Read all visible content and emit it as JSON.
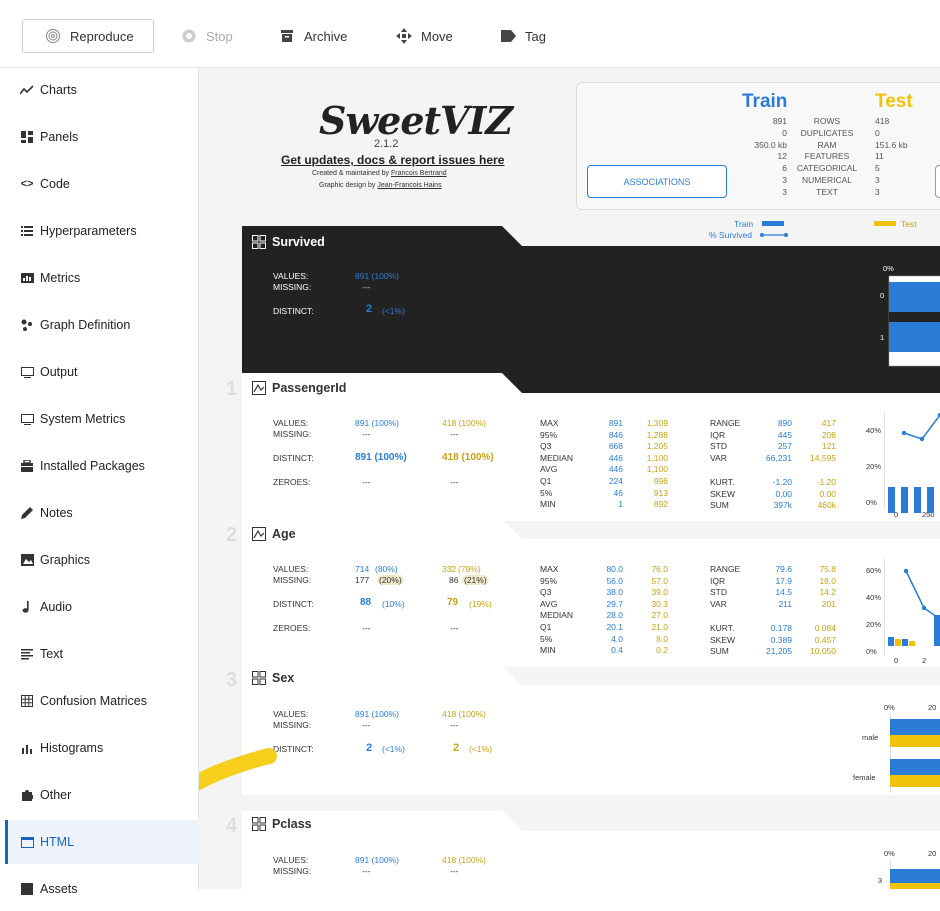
{
  "toolbar": {
    "reproduce": "Reproduce",
    "stop": "Stop",
    "archive": "Archive",
    "move": "Move",
    "tag": "Tag"
  },
  "sidebar": {
    "items": [
      "Charts",
      "Panels",
      "Code",
      "Hyperparameters",
      "Metrics",
      "Graph Definition",
      "Output",
      "System Metrics",
      "Installed Packages",
      "Notes",
      "Graphics",
      "Audio",
      "Text",
      "Confusion Matrices",
      "Histograms",
      "Other",
      "HTML",
      "Assets"
    ],
    "active": "HTML"
  },
  "report": {
    "logo": "SweetVIZ",
    "version": "2.1.2",
    "link": "Get updates, docs & report issues here",
    "credit1": "Created & maintained by",
    "credit1_name": "Francois Bertrand",
    "credit2": "Graphic design by",
    "credit2_name": "Jean-Francois Hains",
    "train_label": "Train",
    "test_label": "Test",
    "summary_rows": [
      {
        "train": "891",
        "label": "ROWS",
        "test": "418"
      },
      {
        "train": "0",
        "label": "DUPLICATES",
        "test": "0"
      },
      {
        "train": "350.0 kb",
        "label": "RAM",
        "test": "151.6 kb"
      },
      {
        "train": "12",
        "label": "FEATURES",
        "test": "11"
      },
      {
        "train": "6",
        "label": "CATEGORICAL",
        "test": "5"
      },
      {
        "train": "3",
        "label": "NUMERICAL",
        "test": "3"
      },
      {
        "train": "3",
        "label": "TEXT",
        "test": "3"
      }
    ],
    "associations": "ASSOCIATIONS",
    "legend": {
      "train": "Train",
      "survived": "% Survived",
      "test": "Test"
    },
    "colors": {
      "train": "#2a7cd6",
      "test": "#f0c20c",
      "dark": "#222222"
    },
    "survived": {
      "title": "Survived",
      "values_l": "VALUES:",
      "values": "891 (100%)",
      "missing_l": "MISSING:",
      "missing": "---",
      "distinct_l": "DISTINCT:",
      "distinct": "2",
      "distinct_pct": "(<1%)",
      "axis_top": "0%",
      "rows": [
        "0",
        "1"
      ]
    },
    "passengerid": {
      "num": "1",
      "title": "PassengerId",
      "values": "891 (100%)",
      "values_t": "418 (100%)",
      "missing": "---",
      "missing_t": "---",
      "distinct": "891 (100%)",
      "distinct_t": "418 (100%)",
      "zeroes": "---",
      "zeroes_t": "---",
      "stats1": [
        [
          "MAX",
          "891",
          "1,309"
        ],
        [
          "95%",
          "846",
          "1,288"
        ],
        [
          "Q3",
          "668",
          "1,205"
        ],
        [
          "MEDIAN",
          "446",
          "1,100"
        ],
        [
          "AVG",
          "446",
          "1,100"
        ],
        [
          "Q1",
          "224",
          "996"
        ],
        [
          "5%",
          "46",
          "913"
        ],
        [
          "MIN",
          "1",
          "892"
        ]
      ],
      "stats2": [
        [
          "RANGE",
          "890",
          "417"
        ],
        [
          "IQR",
          "445",
          "208"
        ],
        [
          "STD",
          "257",
          "121"
        ],
        [
          "VAR",
          "66,231",
          "14,595"
        ],
        [
          "KURT.",
          "-1.20",
          "-1.20"
        ],
        [
          "SKEW",
          "0.00",
          "0.00"
        ],
        [
          "SUM",
          "397k",
          "460k"
        ]
      ],
      "axis": [
        "40%",
        "20%",
        "0%"
      ],
      "xticks": [
        "0",
        "250"
      ]
    },
    "age": {
      "num": "2",
      "title": "Age",
      "values": "714",
      "values_pct": "(80%)",
      "values_t": "332",
      "values_t_pct": "(79%)",
      "missing": "177",
      "missing_pct": "(20%)",
      "missing_t": "86",
      "missing_t_pct": "(21%)",
      "distinct": "88",
      "distinct_pct": "(10%)",
      "distinct_t": "79",
      "distinct_t_pct": "(19%)",
      "zeroes": "---",
      "zeroes_t": "---",
      "stats1": [
        [
          "MAX",
          "80.0",
          "76.0"
        ],
        [
          "95%",
          "56.0",
          "57.0"
        ],
        [
          "Q3",
          "38.0",
          "39.0"
        ],
        [
          "AVG",
          "29.7",
          "30.3"
        ],
        [
          "MEDIAN",
          "28.0",
          "27.0"
        ],
        [
          "Q1",
          "20.1",
          "21.0"
        ],
        [
          "5%",
          "4.0",
          "8.0"
        ],
        [
          "MIN",
          "0.4",
          "0.2"
        ]
      ],
      "stats2": [
        [
          "RANGE",
          "79.6",
          "75.8"
        ],
        [
          "IQR",
          "17.9",
          "18.0"
        ],
        [
          "STD",
          "14.5",
          "14.2"
        ],
        [
          "VAR",
          "211",
          "201"
        ],
        [
          "KURT.",
          "0.178",
          "0.084"
        ],
        [
          "SKEW",
          "0.389",
          "0.457"
        ],
        [
          "SUM",
          "21,205",
          "10,050"
        ]
      ],
      "axis": [
        "60%",
        "40%",
        "20%",
        "0%"
      ],
      "xticks": [
        "0",
        "2"
      ]
    },
    "sex": {
      "num": "3",
      "title": "Sex",
      "values": "891 (100%)",
      "values_t": "418 (100%)",
      "missing": "---",
      "missing_t": "---",
      "distinct": "2",
      "distinct_pct": "(<1%)",
      "distinct_t": "2",
      "distinct_t_pct": "(<1%)",
      "axis": [
        "0%",
        "20"
      ],
      "cats": [
        "male",
        "female"
      ]
    },
    "pclass": {
      "num": "4",
      "title": "Pclass",
      "values": "891 (100%)",
      "values_t": "418 (100%)",
      "missing": "---",
      "missing_t": "---",
      "axis": [
        "0%",
        "20"
      ],
      "cats": [
        "3"
      ]
    },
    "row_labels": {
      "values": "VALUES:",
      "missing": "MISSING:",
      "distinct": "DISTINCT:",
      "zeroes": "ZEROES:"
    }
  }
}
